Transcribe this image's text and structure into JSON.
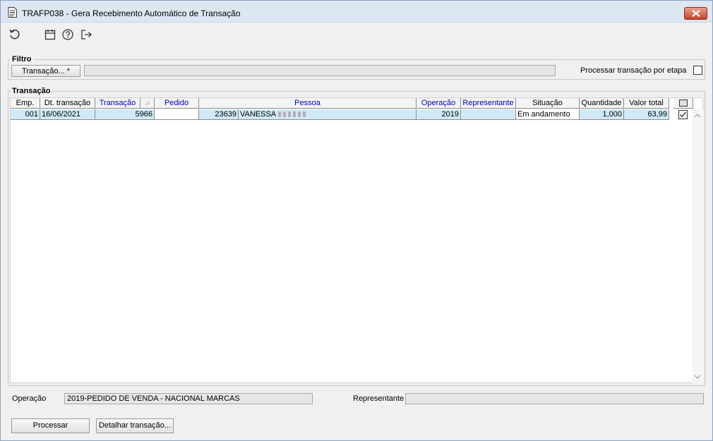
{
  "window": {
    "title": "TRAFP038 - Gera Recebimento Automático de Transação",
    "close_icon": "close-icon"
  },
  "toolbar": {
    "icons": [
      "refresh-icon",
      "calendar-icon",
      "help-icon",
      "exit-icon"
    ]
  },
  "filtro": {
    "title": "Filtro",
    "transacao_button": "Transação... *",
    "transacao_value": "",
    "processar_etapa_label": "Processar transação por etapa",
    "processar_etapa_checked": false
  },
  "transacao": {
    "title": "Transação",
    "columns": [
      "Emp.",
      "Dt. transação",
      "Transação",
      "",
      "Pedido",
      "Pessoa",
      "Operação",
      "Representante",
      "Situação",
      "Quantidade",
      "Valor total",
      ""
    ],
    "rows": [
      {
        "emp": "001",
        "dt_transacao": "16/06/2021",
        "transacao": "5966",
        "pedido": "",
        "pessoa_cod": "23639",
        "pessoa_nome": "VANESSA",
        "operacao": "2019",
        "representante": "",
        "situacao": "Em andamento",
        "quantidade": "1,000",
        "valor_total": "63,99",
        "selected": true
      }
    ]
  },
  "footer": {
    "operacao_label": "Operação",
    "operacao_value": "2019-PEDIDO DE VENDA - NACIONAL MARCAS",
    "representante_label": "Representante",
    "representante_value": ""
  },
  "buttons": {
    "processar": "Processar",
    "detalhar": "Detalhar transação..."
  },
  "colors": {
    "selected_row": "#cfeaf6",
    "header_blue_text": "#0000b0",
    "close_button": "#c6452a"
  }
}
